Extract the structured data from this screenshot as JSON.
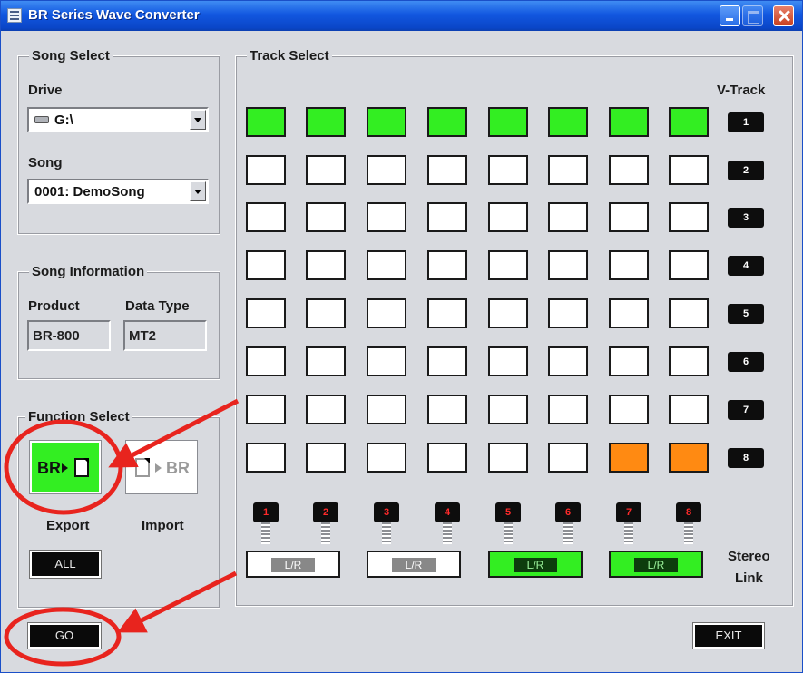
{
  "window": {
    "title": "BR Series Wave Converter"
  },
  "song_select": {
    "title": "Song Select",
    "drive_label": "Drive",
    "drive_value": "G:\\",
    "song_label": "Song",
    "song_value": "0001: DemoSong"
  },
  "song_info": {
    "title": "Song Information",
    "product_label": "Product",
    "product_value": "BR-800",
    "data_type_label": "Data Type",
    "data_type_value": "MT2"
  },
  "function_select": {
    "title": "Function Select",
    "export_icon_text": "BR",
    "import_icon_text": "BR",
    "export_label": "Export",
    "import_label": "Import",
    "all_button": "ALL",
    "go_button": "GO"
  },
  "track_select": {
    "title": "Track Select",
    "vtrack_header": "V-Track",
    "vtracks": [
      "1",
      "2",
      "3",
      "4",
      "5",
      "6",
      "7",
      "8"
    ],
    "grid": [
      [
        "selected",
        "selected",
        "selected",
        "selected",
        "selected",
        "selected",
        "selected",
        "selected"
      ],
      [
        "empty",
        "empty",
        "empty",
        "empty",
        "empty",
        "empty",
        "empty",
        "empty"
      ],
      [
        "empty",
        "empty",
        "empty",
        "empty",
        "empty",
        "empty",
        "empty",
        "empty"
      ],
      [
        "empty",
        "empty",
        "empty",
        "empty",
        "empty",
        "empty",
        "empty",
        "empty"
      ],
      [
        "empty",
        "empty",
        "empty",
        "empty",
        "empty",
        "empty",
        "empty",
        "empty"
      ],
      [
        "empty",
        "empty",
        "empty",
        "empty",
        "empty",
        "empty",
        "empty",
        "empty"
      ],
      [
        "empty",
        "empty",
        "empty",
        "empty",
        "empty",
        "empty",
        "empty",
        "empty"
      ],
      [
        "empty",
        "empty",
        "empty",
        "empty",
        "empty",
        "empty",
        "alt",
        "alt"
      ]
    ],
    "tracks": [
      "1",
      "2",
      "3",
      "4",
      "5",
      "6",
      "7",
      "8"
    ],
    "stereo_links": [
      {
        "label": "L/R",
        "on": false
      },
      {
        "label": "L/R",
        "on": false
      },
      {
        "label": "L/R",
        "on": true
      },
      {
        "label": "L/R",
        "on": true
      }
    ],
    "stereo_link_label_1": "Stereo",
    "stereo_link_label_2": "Link"
  },
  "exit_button": "EXIT",
  "colors": {
    "selected": "#33ee22",
    "alt": "#ff8a12",
    "annotation": "#e8241e"
  }
}
